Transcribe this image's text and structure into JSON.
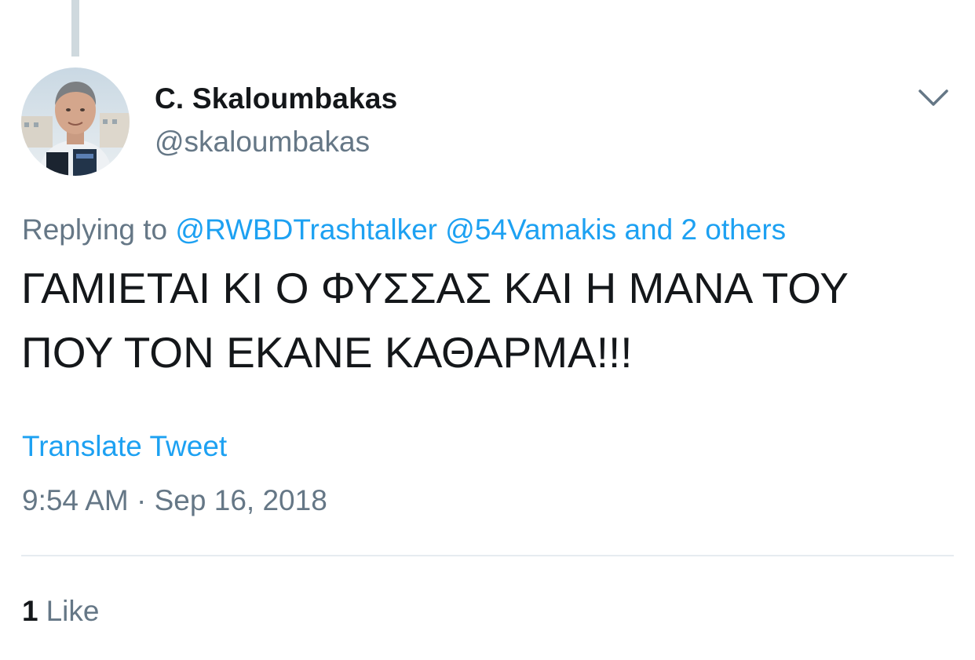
{
  "tweet": {
    "author": {
      "display_name": "C. Skaloumbakas",
      "handle": "@skaloumbakas",
      "avatar_icon": "user-avatar"
    },
    "menu_icon": "chevron-down-icon",
    "reply": {
      "prefix": "Replying to",
      "mention_1": "@RWBDTrashtalker",
      "mention_2": "@54Vamakis",
      "others": "and 2 others"
    },
    "text_line_1": "ΓΑΜΙΕΤΑΙ ΚΙ Ο ΦΥΣΣΑΣ ΚΑΙ Η ΜΑΝΑ ΤΟΥ",
    "text_line_2": "ΠΟΥ ΤΟΝ ΕΚΑΝΕ ΚΑΘΑΡΜΑ!!!",
    "translate_label": "Translate Tweet",
    "timestamp": "9:54 AM · Sep 16, 2018",
    "likes": {
      "count": "1",
      "label": "Like"
    }
  },
  "colors": {
    "link": "#1da1f2",
    "text": "#14171a",
    "secondary": "#657786",
    "divider": "#e6ecf0",
    "thread_line": "#cfd9de"
  }
}
